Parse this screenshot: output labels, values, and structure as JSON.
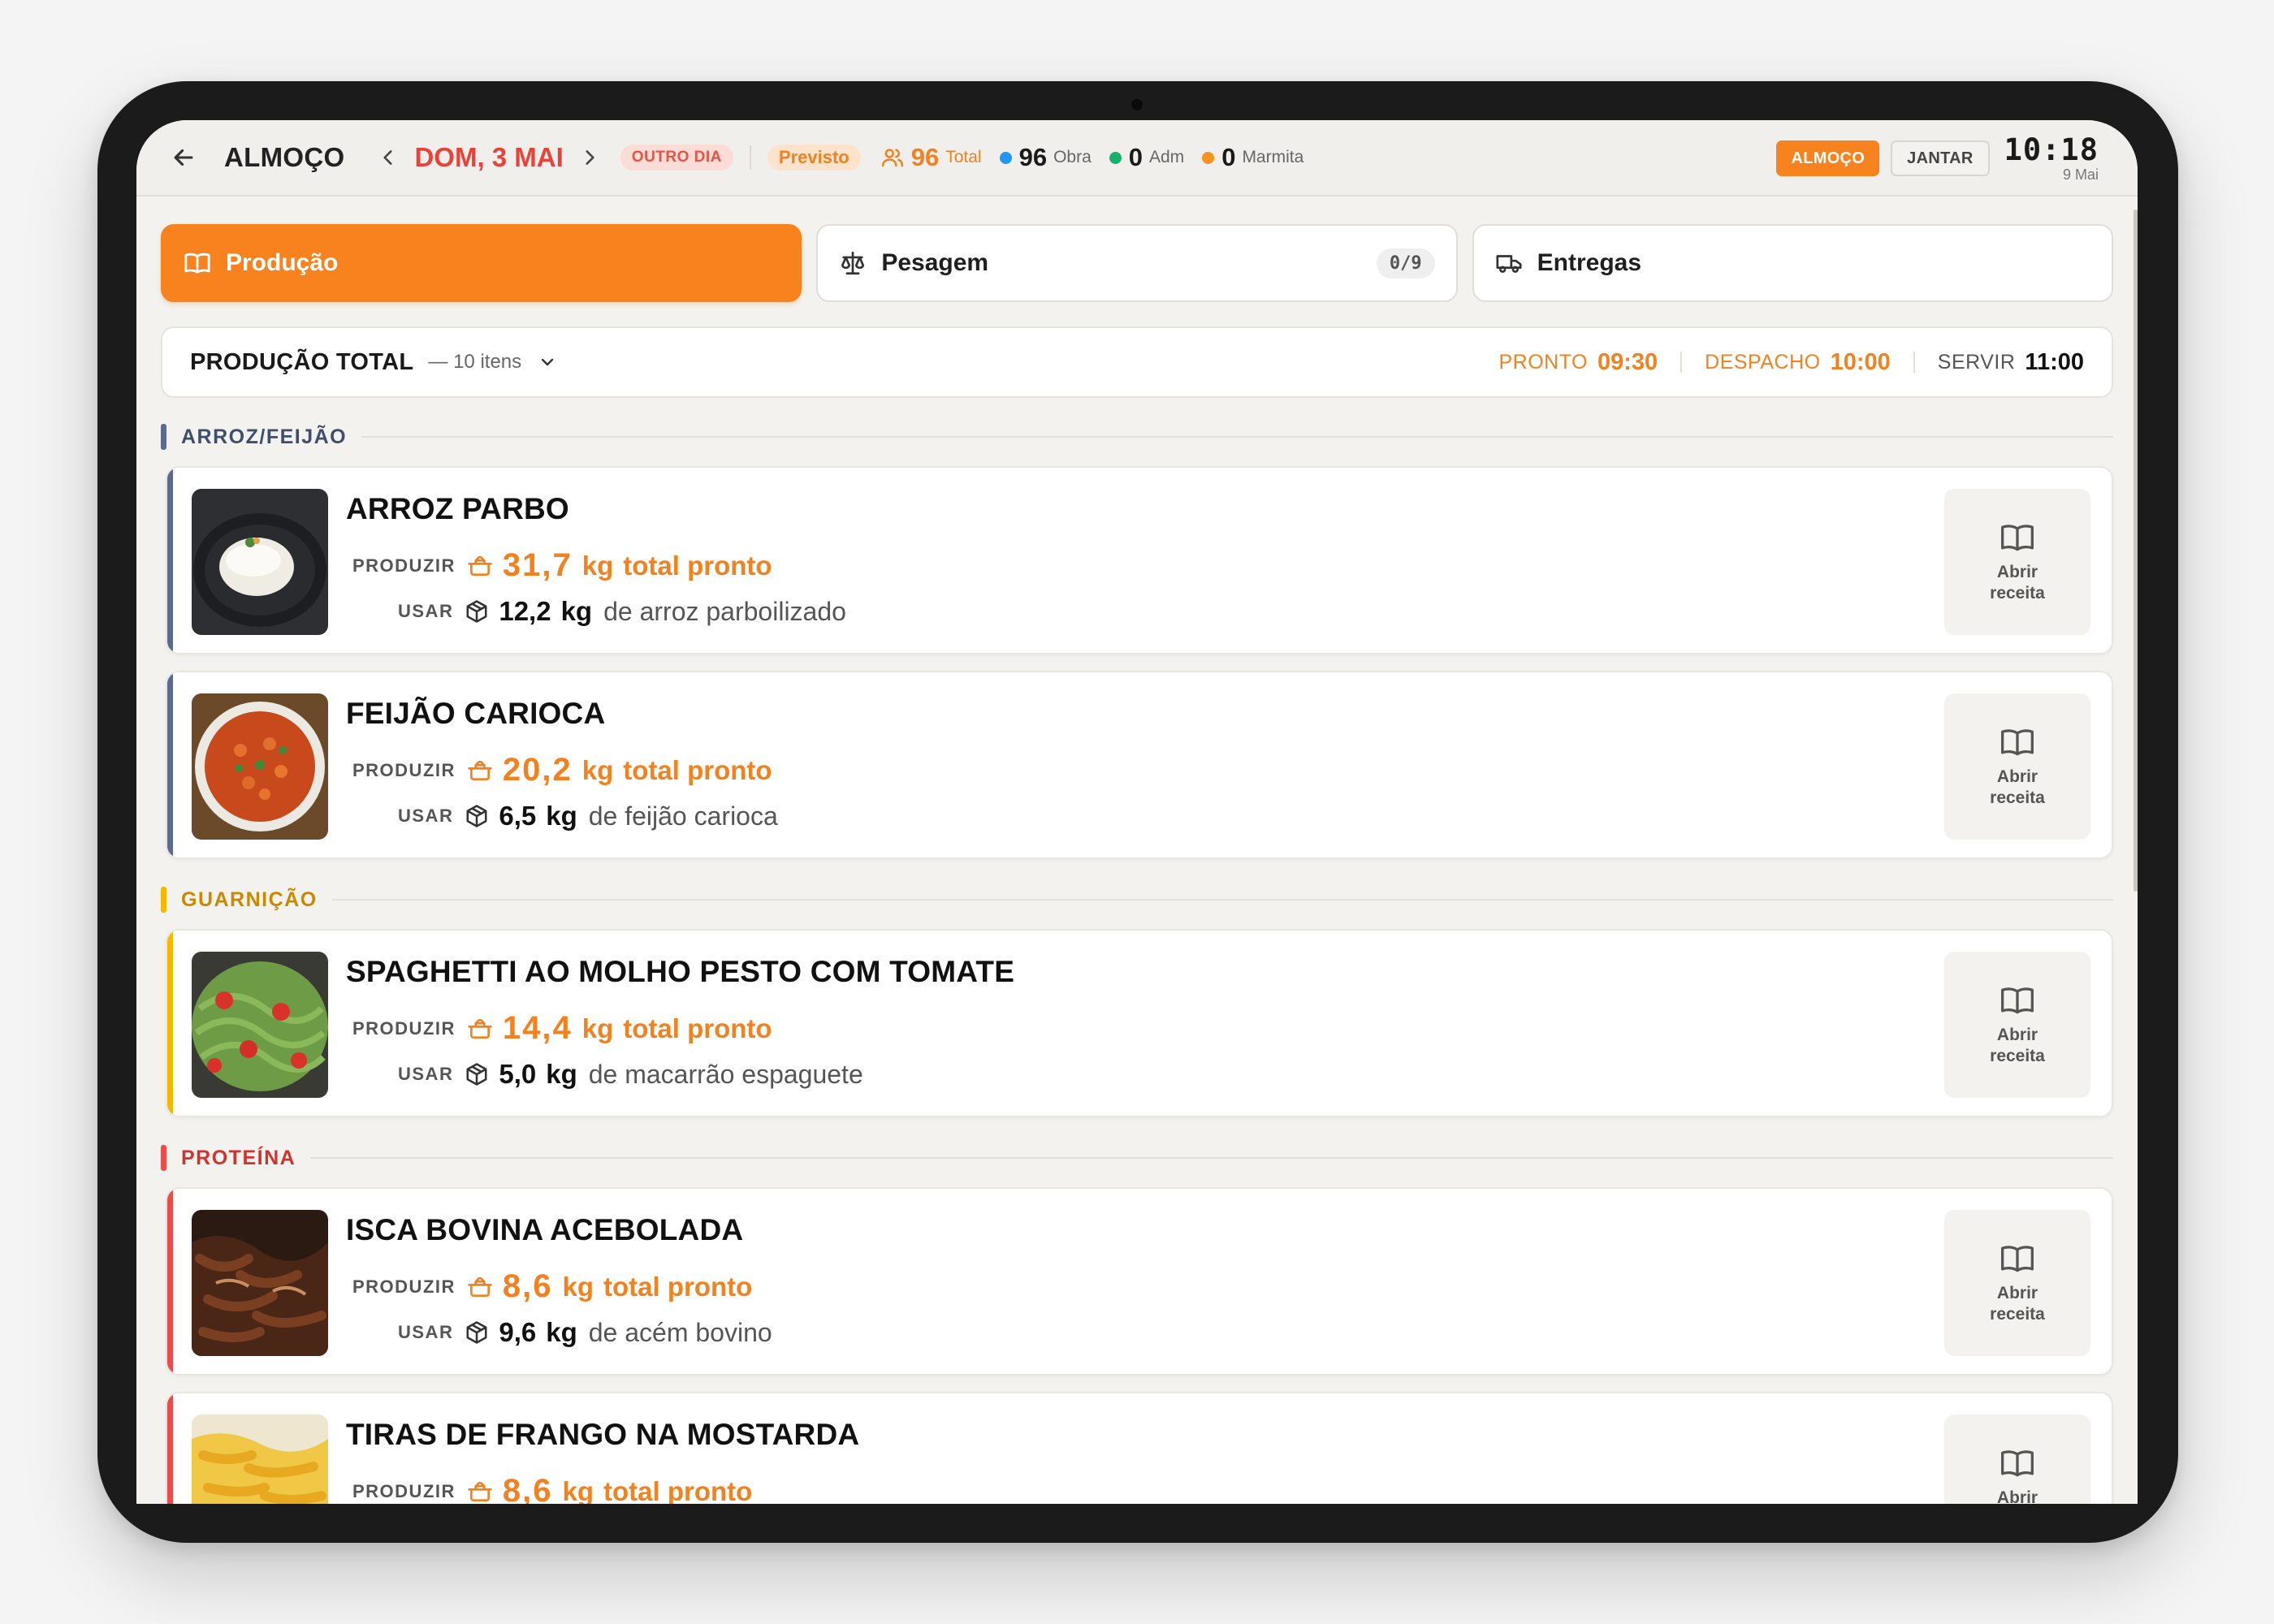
{
  "header": {
    "meal_title": "ALMOÇO",
    "date": "DOM, 3 MAI",
    "other_day_badge": "OUTRO DIA",
    "forecast_badge": "Previsto",
    "stats": [
      {
        "value": "96",
        "label": "Total",
        "color": "#f2821f"
      },
      {
        "value": "96",
        "label": "Obra",
        "color": "#2196f3"
      },
      {
        "value": "0",
        "label": "Adm",
        "color": "#17b26a"
      },
      {
        "value": "0",
        "label": "Marmita",
        "color": "#f7931e"
      }
    ],
    "meal_buttons": [
      "ALMOÇO",
      "JANTAR"
    ],
    "clock_time": "10:18",
    "clock_date": "9 Mai"
  },
  "tabs": [
    {
      "label": "Produção",
      "icon": "book-icon",
      "active": true
    },
    {
      "label": "Pesagem",
      "icon": "scale-icon",
      "count": "0/9"
    },
    {
      "label": "Entregas",
      "icon": "truck-icon"
    }
  ],
  "summary": {
    "title": "PRODUÇÃO TOTAL",
    "items": "— 10 itens",
    "schedule": [
      {
        "label": "PRONTO",
        "time": "09:30"
      },
      {
        "label": "DESPACHO",
        "time": "10:00"
      },
      {
        "label": "SERVIR",
        "time": "11:00"
      }
    ]
  },
  "labels": {
    "produce": "PRODUZIR",
    "use": "USAR",
    "total_ready": "total pronto",
    "open_recipe": "Abrir receita"
  },
  "sections": [
    {
      "name": "ARROZ/FEIJÃO",
      "color": "#5a6b8c"
    },
    {
      "name": "GUARNIÇÃO",
      "color": "#f5b800"
    },
    {
      "name": "PROTEÍNA",
      "color": "#ef4a4a"
    }
  ],
  "dishes": [
    {
      "name": "ARROZ PARBO",
      "produce": "31,7",
      "produce_unit": "kg",
      "use": "12,2",
      "use_unit": "kg",
      "ingredient": "de arroz parboilizado"
    },
    {
      "name": "FEIJÃO CARIOCA",
      "produce": "20,2",
      "produce_unit": "kg",
      "use": "6,5",
      "use_unit": "kg",
      "ingredient": "de feijão carioca"
    },
    {
      "name": "SPAGHETTI AO MOLHO PESTO COM TOMATE",
      "produce": "14,4",
      "produce_unit": "kg",
      "use": "5,0",
      "use_unit": "kg",
      "ingredient": "de macarrão espaguete"
    },
    {
      "name": "ISCA BOVINA ACEBOLADA",
      "produce": "8,6",
      "produce_unit": "kg",
      "use": "9,6",
      "use_unit": "kg",
      "ingredient": "de acém bovino"
    },
    {
      "name": "TIRAS DE FRANGO NA MOSTARDA",
      "produce": "8,6",
      "produce_unit": "kg",
      "use": "",
      "use_unit": "",
      "ingredient": ""
    }
  ],
  "colors": {
    "accent": "#f7821e",
    "date_red": "#e8433b"
  }
}
